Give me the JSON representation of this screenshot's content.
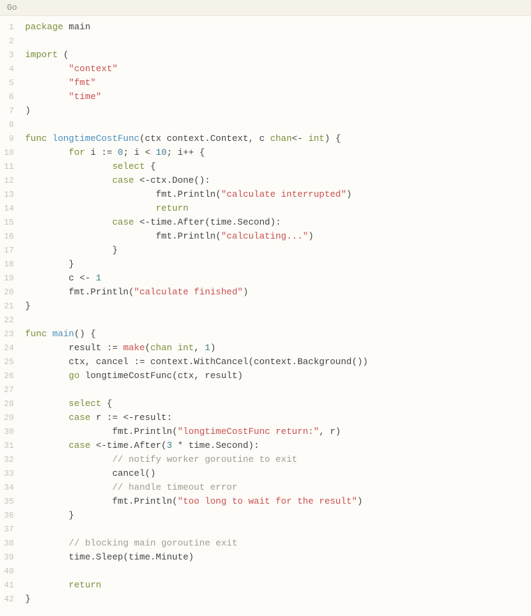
{
  "header": {
    "title": "Go"
  },
  "lines": [
    [
      {
        "t": "package ",
        "c": "kw"
      },
      {
        "t": "main",
        "c": "id"
      }
    ],
    [],
    [
      {
        "t": "import ",
        "c": "kw"
      },
      {
        "t": "(",
        "c": "op"
      }
    ],
    [
      {
        "t": "        ",
        "c": "id"
      },
      {
        "t": "\"context\"",
        "c": "str"
      }
    ],
    [
      {
        "t": "        ",
        "c": "id"
      },
      {
        "t": "\"fmt\"",
        "c": "str"
      }
    ],
    [
      {
        "t": "        ",
        "c": "id"
      },
      {
        "t": "\"time\"",
        "c": "str"
      }
    ],
    [
      {
        "t": ")",
        "c": "op"
      }
    ],
    [],
    [
      {
        "t": "func ",
        "c": "kw"
      },
      {
        "t": "longtimeCostFunc",
        "c": "fn"
      },
      {
        "t": "(ctx context.Context, c ",
        "c": "id"
      },
      {
        "t": "chan",
        "c": "kw"
      },
      {
        "t": "<- ",
        "c": "op"
      },
      {
        "t": "int",
        "c": "kw"
      },
      {
        "t": ") {",
        "c": "op"
      }
    ],
    [
      {
        "t": "        ",
        "c": "id"
      },
      {
        "t": "for ",
        "c": "kw"
      },
      {
        "t": "i := ",
        "c": "id"
      },
      {
        "t": "0",
        "c": "num"
      },
      {
        "t": "; i < ",
        "c": "id"
      },
      {
        "t": "10",
        "c": "num"
      },
      {
        "t": "; i++ {",
        "c": "id"
      }
    ],
    [
      {
        "t": "                ",
        "c": "id"
      },
      {
        "t": "select ",
        "c": "kw"
      },
      {
        "t": "{",
        "c": "op"
      }
    ],
    [
      {
        "t": "                ",
        "c": "id"
      },
      {
        "t": "case ",
        "c": "kw"
      },
      {
        "t": "<-ctx.Done():",
        "c": "id"
      }
    ],
    [
      {
        "t": "                        fmt.Println(",
        "c": "id"
      },
      {
        "t": "\"calculate interrupted\"",
        "c": "str"
      },
      {
        "t": ")",
        "c": "id"
      }
    ],
    [
      {
        "t": "                        ",
        "c": "id"
      },
      {
        "t": "return",
        "c": "kw"
      }
    ],
    [
      {
        "t": "                ",
        "c": "id"
      },
      {
        "t": "case ",
        "c": "kw"
      },
      {
        "t": "<-time.After(time.Second):",
        "c": "id"
      }
    ],
    [
      {
        "t": "                        fmt.Println(",
        "c": "id"
      },
      {
        "t": "\"calculating...\"",
        "c": "str"
      },
      {
        "t": ")",
        "c": "id"
      }
    ],
    [
      {
        "t": "                }",
        "c": "id"
      }
    ],
    [
      {
        "t": "        }",
        "c": "id"
      }
    ],
    [
      {
        "t": "        c <- ",
        "c": "id"
      },
      {
        "t": "1",
        "c": "num"
      }
    ],
    [
      {
        "t": "        fmt.Println(",
        "c": "id"
      },
      {
        "t": "\"calculate finished\"",
        "c": "str"
      },
      {
        "t": ")",
        "c": "id"
      }
    ],
    [
      {
        "t": "}",
        "c": "op"
      }
    ],
    [],
    [
      {
        "t": "func ",
        "c": "kw"
      },
      {
        "t": "main",
        "c": "fn"
      },
      {
        "t": "() {",
        "c": "op"
      }
    ],
    [
      {
        "t": "        result := ",
        "c": "id"
      },
      {
        "t": "make",
        "c": "bi"
      },
      {
        "t": "(",
        "c": "op"
      },
      {
        "t": "chan int",
        "c": "kw"
      },
      {
        "t": ", ",
        "c": "id"
      },
      {
        "t": "1",
        "c": "num"
      },
      {
        "t": ")",
        "c": "op"
      }
    ],
    [
      {
        "t": "        ctx, cancel := context.WithCancel(context.Background())",
        "c": "id"
      }
    ],
    [
      {
        "t": "        ",
        "c": "id"
      },
      {
        "t": "go ",
        "c": "kw"
      },
      {
        "t": "longtimeCostFunc(ctx, result)",
        "c": "id"
      }
    ],
    [],
    [
      {
        "t": "        ",
        "c": "id"
      },
      {
        "t": "select ",
        "c": "kw"
      },
      {
        "t": "{",
        "c": "op"
      }
    ],
    [
      {
        "t": "        ",
        "c": "id"
      },
      {
        "t": "case ",
        "c": "kw"
      },
      {
        "t": "r := <-result:",
        "c": "id"
      }
    ],
    [
      {
        "t": "                fmt.Println(",
        "c": "id"
      },
      {
        "t": "\"longtimeCostFunc return:\"",
        "c": "str"
      },
      {
        "t": ", r)",
        "c": "id"
      }
    ],
    [
      {
        "t": "        ",
        "c": "id"
      },
      {
        "t": "case ",
        "c": "kw"
      },
      {
        "t": "<-time.After(",
        "c": "id"
      },
      {
        "t": "3",
        "c": "num"
      },
      {
        "t": " * time.Second):",
        "c": "id"
      }
    ],
    [
      {
        "t": "                ",
        "c": "id"
      },
      {
        "t": "// notify worker goroutine to exit",
        "c": "cm"
      }
    ],
    [
      {
        "t": "                cancel()",
        "c": "id"
      }
    ],
    [
      {
        "t": "                ",
        "c": "id"
      },
      {
        "t": "// handle timeout error",
        "c": "cm"
      }
    ],
    [
      {
        "t": "                fmt.Println(",
        "c": "id"
      },
      {
        "t": "\"too long to wait for the result\"",
        "c": "str"
      },
      {
        "t": ")",
        "c": "id"
      }
    ],
    [
      {
        "t": "        }",
        "c": "id"
      }
    ],
    [],
    [
      {
        "t": "        ",
        "c": "id"
      },
      {
        "t": "// blocking main goroutine exit",
        "c": "cm"
      }
    ],
    [
      {
        "t": "        time.Sleep(time.Minute)",
        "c": "id"
      }
    ],
    [],
    [
      {
        "t": "        ",
        "c": "id"
      },
      {
        "t": "return",
        "c": "kw"
      }
    ],
    [
      {
        "t": "}",
        "c": "op"
      }
    ]
  ]
}
